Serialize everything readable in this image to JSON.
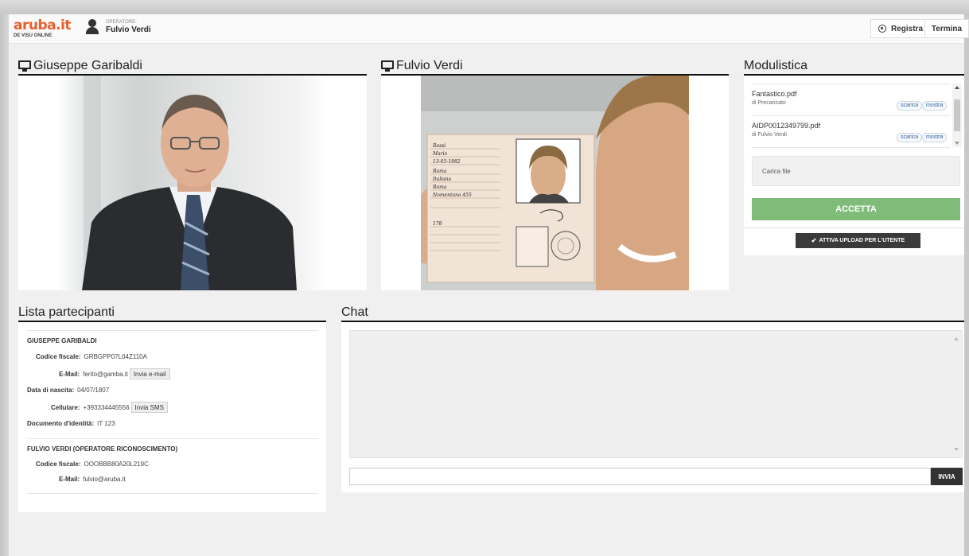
{
  "header": {
    "logo_text": "aruba.it",
    "logo_sub": "DE VISU ONLINE",
    "operator_label": "OPERATORE:",
    "operator_name": "Fulvio Verdi",
    "registra_label": "Registra",
    "termina_label": "Termina"
  },
  "video_left": {
    "title": "Giuseppe Garibaldi"
  },
  "video_right": {
    "title": "Fulvio Verdi"
  },
  "modulistica": {
    "title": "Modulistica",
    "files": [
      {
        "name": "Fantastico.pdf",
        "by": "di Precaricato",
        "download": "scarica",
        "show": "mostra"
      },
      {
        "name": "AIDP0012349799.pdf",
        "by": "di Fulvio Verdi",
        "download": "scarica",
        "show": "mostra"
      }
    ],
    "upload_label": "Carica file",
    "accept_label": "ACCETTA",
    "enable_upload_label": "ATTIVA UPLOAD PER L'UTENTE"
  },
  "participants": {
    "title": "Lista partecipanti",
    "list": [
      {
        "name": "GIUSEPPE GARIBALDI",
        "cf_label": "Codice fiscale:",
        "cf": "GRBGPP07L04Z110A",
        "email_label": "E-Mail:",
        "email": "ferito@gamba.it",
        "email_btn": "Invia e-mail",
        "dob_label": "Data di nascita:",
        "dob": "04/07/1807",
        "phone_label": "Cellulare:",
        "phone": "+393334445556",
        "sms_btn": "Invia SMS",
        "doc_label": "Documento d'identità:",
        "doc": "IT 123"
      },
      {
        "name": "FULVIO VERDI (OPERATORE RICONOSCIMENTO)",
        "cf_label": "Codice fiscale:",
        "cf": "OOOBBB80A20L219C",
        "email_label": "E-Mail:",
        "email": "fulvio@aruba.it"
      }
    ]
  },
  "chat": {
    "title": "Chat",
    "input_value": "",
    "send_label": "INVIA"
  },
  "id_card": {
    "surname": "Rossi",
    "name": "Mario",
    "birth_date": "13-05-1982",
    "birth_place": "Roma",
    "citizenship": "Italiana",
    "residence": "Roma",
    "address": "Nomentana 455",
    "height": "178"
  }
}
